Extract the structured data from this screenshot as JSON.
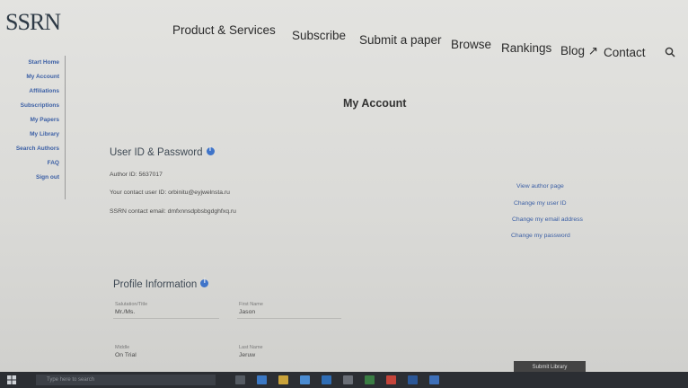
{
  "header": {
    "logo": "SSRN",
    "nav": [
      {
        "label": "Product & Services"
      },
      {
        "label": "Subscribe"
      },
      {
        "label": "Submit a paper"
      },
      {
        "label": "Browse"
      },
      {
        "label": "Rankings"
      },
      {
        "label": "Blog ↗"
      },
      {
        "label": "Contact"
      }
    ],
    "search_icon": "search-icon"
  },
  "sidebar": {
    "items": [
      {
        "label": "Start Home"
      },
      {
        "label": "My Account"
      },
      {
        "label": "Affiliations"
      },
      {
        "label": "Subscriptions"
      },
      {
        "label": "My Papers"
      },
      {
        "label": "My Library"
      },
      {
        "label": "Search Authors"
      },
      {
        "label": "FAQ"
      },
      {
        "label": "Sign out"
      }
    ]
  },
  "main": {
    "title": "My Account",
    "user_id_section": {
      "title": "User ID & Password",
      "rows": [
        {
          "text": "Author ID: 5637017"
        },
        {
          "text": "Your contact user ID: orbinitu@eyjwelnsta.ru"
        },
        {
          "text": "SSRN contact email: dmfxnnsdpbsbgdghfxq.ru"
        }
      ],
      "links": [
        {
          "label": "View author page"
        },
        {
          "label": "Change my user ID"
        },
        {
          "label": "Change my email address"
        },
        {
          "label": "Change my password"
        }
      ]
    },
    "profile_section": {
      "title": "Profile Information",
      "fields": [
        {
          "label": "Salutation/Title",
          "value": "Mr./Ms."
        },
        {
          "label": "First Name",
          "value": "Jason"
        },
        {
          "label": "Middle",
          "value": "On Trial"
        },
        {
          "label": "Last Name",
          "value": "Jeruw"
        }
      ]
    }
  },
  "taskbar": {
    "search_placeholder": "Type here to search",
    "tooltip": "Submit Library"
  }
}
